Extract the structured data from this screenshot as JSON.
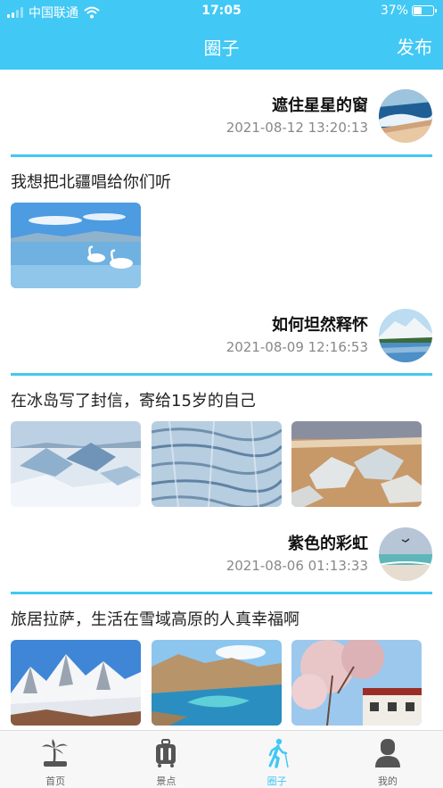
{
  "status_bar": {
    "carrier": "中国联通",
    "time": "17:05",
    "battery": "37%",
    "battery_level": 0.37
  },
  "nav": {
    "title": "圈子",
    "publish_label": "发布"
  },
  "posts": [
    {
      "author": "遮住星星的窗",
      "date": "2021-08-12 13:20:13",
      "text": "我想把北疆唱给你们听",
      "avatar_icon": "ocean-wave-icon",
      "images": [
        "swans-lake-image"
      ]
    },
    {
      "author": "如何坦然释怀",
      "date": "2021-08-09 12:16:53",
      "text": "在冰岛写了封信，寄给15岁的自己",
      "avatar_icon": "snow-mountain-lake-icon",
      "images": [
        "glacier-image",
        "ice-crevasses-image",
        "ice-on-beach-image"
      ]
    },
    {
      "author": "紫色的彩虹",
      "date": "2021-08-06 01:13:33",
      "text": "旅居拉萨，生活在雪域高原的人真幸福啊",
      "avatar_icon": "beach-bird-icon",
      "images": [
        "snow-peaks-image",
        "turquoise-lake-image",
        "cherry-blossom-house-image"
      ]
    }
  ],
  "tabbar": {
    "items": [
      {
        "label": "首页",
        "icon": "palm-tree-icon",
        "active": false
      },
      {
        "label": "景点",
        "icon": "suitcase-icon",
        "active": false
      },
      {
        "label": "圈子",
        "icon": "walking-person-icon",
        "active": true
      },
      {
        "label": "我的",
        "icon": "user-icon",
        "active": false
      }
    ]
  },
  "colors": {
    "accent": "#42c8f4",
    "inactive_icon": "#555555",
    "inactive_label": "#666666"
  }
}
